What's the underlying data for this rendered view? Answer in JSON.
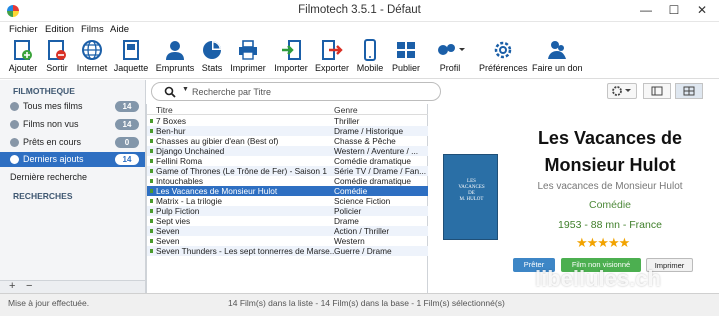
{
  "window": {
    "title": "Filmotech 3.5.1 - Défaut"
  },
  "menu": [
    "Fichier",
    "Edition",
    "Films",
    "Aide"
  ],
  "toolbar": [
    {
      "label": "Ajouter",
      "icon": "add-film-icon"
    },
    {
      "label": "Sortir",
      "icon": "remove-film-icon"
    },
    {
      "label": "Internet",
      "icon": "globe-icon"
    },
    {
      "label": "Jaquette",
      "icon": "cover-icon"
    },
    {
      "label": "Emprunts",
      "icon": "person-icon"
    },
    {
      "label": "Stats",
      "icon": "pie-chart-icon"
    },
    {
      "label": "Imprimer",
      "icon": "printer-icon"
    },
    {
      "label": "Importer",
      "icon": "import-icon"
    },
    {
      "label": "Exporter",
      "icon": "export-icon"
    },
    {
      "label": "Mobile",
      "icon": "mobile-icon"
    },
    {
      "label": "Publier",
      "icon": "publish-icon"
    },
    {
      "label": "Profil",
      "icon": "profile-icon"
    },
    {
      "label": "Préférences",
      "icon": "gear-icon"
    },
    {
      "label": "Faire un don",
      "icon": "donate-icon"
    }
  ],
  "sidebar": {
    "section1": "FILMOTHEQUE",
    "items": [
      {
        "label": "Tous mes films",
        "count": "14"
      },
      {
        "label": "Films non vus",
        "count": "14"
      },
      {
        "label": "Prêts en cours",
        "count": "0"
      },
      {
        "label": "Derniers ajouts",
        "count": "14"
      }
    ],
    "last_search": "Dernière recherche",
    "section2": "RECHERCHES",
    "add": "+",
    "remove": "−"
  },
  "search": {
    "placeholder": "Recherche par Titre"
  },
  "list": {
    "col_title": "Titre",
    "col_genre": "Genre",
    "rows": [
      {
        "title": "7 Boxes",
        "genre": "Thriller"
      },
      {
        "title": "Ben-hur",
        "genre": "Drame / Historique"
      },
      {
        "title": "Chasses au gibier d'ean (Best of)",
        "genre": "Chasse & Pêche"
      },
      {
        "title": "Django Unchained",
        "genre": "Western / Aventure / ..."
      },
      {
        "title": "Fellini Roma",
        "genre": "Comédie dramatique"
      },
      {
        "title": "Game of Thrones (Le Trône de Fer) - Saison 1",
        "genre": "Série TV / Drame / Fan..."
      },
      {
        "title": "Intouchables",
        "genre": "Comédie dramatique"
      },
      {
        "title": "Les Vacances de Monsieur Hulot",
        "genre": "Comédie"
      },
      {
        "title": "Matrix - La trilogie",
        "genre": "Science Fiction"
      },
      {
        "title": "Pulp Fiction",
        "genre": "Policier"
      },
      {
        "title": "Sept vies",
        "genre": "Drame"
      },
      {
        "title": "Seven",
        "genre": "Action / Thriller"
      },
      {
        "title": "Seven",
        "genre": "Western"
      },
      {
        "title": "Seven Thunders - Les sept tonnerres de Marse...",
        "genre": "Guerre / Drame"
      }
    ],
    "selected_index": 7
  },
  "detail": {
    "title_line1": "Les Vacances de",
    "title_line2": "Monsieur Hulot",
    "original_title": "Les vacances de Monsieur Hulot",
    "genre": "Comédie",
    "info": "1953 - 88 mn - France",
    "stars": "★★★★★",
    "poster_line1": "LES",
    "poster_line2": "VACANCES",
    "poster_line3": "DE",
    "poster_line4": "M. HULOT",
    "btn_lend": "Prêter",
    "btn_unseen": "Film non visionné",
    "btn_print": "Imprimer"
  },
  "status": {
    "left": "Mise à jour effectuée.",
    "center": "14 Film(s) dans la liste - 14 Film(s) dans la base - 1 Film(s) sélectionné(s)"
  },
  "watermark": "libellules.ch"
}
